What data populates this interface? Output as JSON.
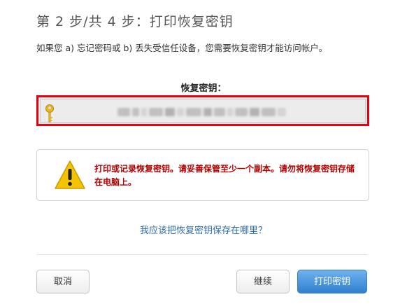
{
  "page": {
    "step_title": "第 2 步/共 4 步：打印恢复密钥",
    "instruction": "如果您 a) 忘记密码或 b) 丢失受信任设备，您需要恢复密钥才能访问帐户。"
  },
  "recovery_key": {
    "label": "恢复密钥：",
    "value_obscured": true,
    "icon": "key-icon"
  },
  "warning": {
    "icon": "warning-triangle-icon",
    "text": "打印或记录恢复密钥。请妥善保管至少一个副本。请勿将恢复密钥存储在电脑上。"
  },
  "help_link": "我应该把恢复密钥保存在哪里？",
  "buttons": {
    "cancel": "取消",
    "continue": "继续",
    "print": "打印密钥"
  },
  "colors": {
    "highlight_border": "#e60012",
    "warning_text": "#b10000",
    "link": "#2e6da4",
    "primary_button": "#2f80d1"
  }
}
